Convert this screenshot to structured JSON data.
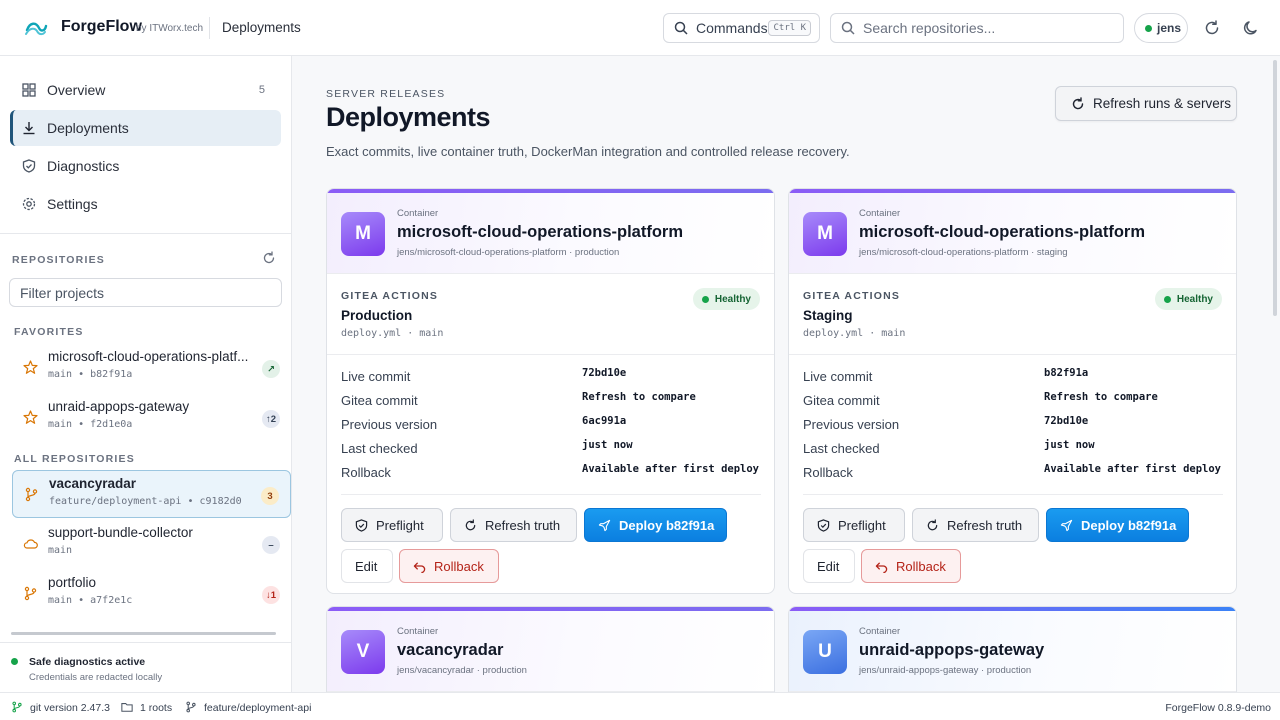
{
  "header": {
    "brand": "ForgeFlow",
    "brand_by": "by ITWorx.tech",
    "breadcrumb": "Deployments",
    "commands_label": "Commands",
    "commands_shortcut": "Ctrl K",
    "search_placeholder": "Search repositories...",
    "user": "jens",
    "icons": [
      "logo-icon",
      "search-icon",
      "refresh-icon",
      "moon-icon"
    ]
  },
  "sidebar": {
    "nav": [
      {
        "label": "Overview",
        "icon": "grid-icon",
        "count": "5"
      },
      {
        "label": "Deployments",
        "icon": "download-icon",
        "active": true
      },
      {
        "label": "Diagnostics",
        "icon": "shield-icon"
      },
      {
        "label": "Settings",
        "icon": "gear-icon"
      }
    ],
    "repositories_label": "REPOSITORIES",
    "filter_placeholder": "Filter projects",
    "favorites_label": "FAVORITES",
    "favorites": [
      {
        "name": "microsoft-cloud-operations-platf...",
        "sub": "main • b82f91a",
        "badge": "↗",
        "icon": "star-icon"
      },
      {
        "name": "unraid-appops-gateway",
        "sub": "main • f2d1e0a",
        "badge": "↑2",
        "icon": "star-icon"
      }
    ],
    "all_label": "ALL REPOSITORIES",
    "all": [
      {
        "name": "vacancyradar",
        "sub": "feature/deployment-api • c9182d0",
        "badge": "3",
        "icon": "branch-icon",
        "active": true
      },
      {
        "name": "support-bundle-collector",
        "sub": "main",
        "badge": "–",
        "icon": "cloud-icon"
      },
      {
        "name": "portfolio",
        "sub": "main • a7f2e1c",
        "badge": "↓1",
        "icon": "branch-icon"
      }
    ],
    "footer_title": "Safe diagnostics active",
    "footer_sub": "Credentials are redacted locally"
  },
  "main": {
    "kicker": "SERVER RELEASES",
    "title": "Deployments",
    "description": "Exact commits, live container truth, DockerMan integration and controlled release recovery.",
    "refresh_button": "Refresh runs & servers",
    "cards": [
      {
        "avatar": "M",
        "kind": "Container",
        "name": "microsoft-cloud-operations-platform",
        "path": "jens/microsoft-cloud-operations-platform · production",
        "actions_label": "GITEA ACTIONS",
        "env": "Production",
        "workflow": "deploy.yml · main",
        "health": "Healthy",
        "rows": [
          {
            "k": "Live commit",
            "v": "72bd10e"
          },
          {
            "k": "Gitea commit",
            "v": "Refresh to compare"
          },
          {
            "k": "Previous version",
            "v": "6ac991a"
          },
          {
            "k": "Last checked",
            "v": "just now"
          },
          {
            "k": "Rollback",
            "v": "Available after first deploy"
          }
        ],
        "preflight": "Preflight",
        "refresh_truth": "Refresh truth",
        "deploy": "Deploy b82f91a",
        "edit": "Edit",
        "rollback": "Rollback"
      },
      {
        "avatar": "M",
        "kind": "Container",
        "name": "microsoft-cloud-operations-platform",
        "path": "jens/microsoft-cloud-operations-platform · staging",
        "actions_label": "GITEA ACTIONS",
        "env": "Staging",
        "workflow": "deploy.yml · main",
        "health": "Healthy",
        "rows": [
          {
            "k": "Live commit",
            "v": "b82f91a"
          },
          {
            "k": "Gitea commit",
            "v": "Refresh to compare"
          },
          {
            "k": "Previous version",
            "v": "72bd10e"
          },
          {
            "k": "Last checked",
            "v": "just now"
          },
          {
            "k": "Rollback",
            "v": "Available after first deploy"
          }
        ],
        "preflight": "Preflight",
        "refresh_truth": "Refresh truth",
        "deploy": "Deploy b82f91a",
        "edit": "Edit",
        "rollback": "Rollback"
      },
      {
        "avatar": "V",
        "kind": "Container",
        "name": "vacancyradar",
        "path": "jens/vacancyradar · production"
      },
      {
        "avatar": "U",
        "kind": "Container",
        "name": "unraid-appops-gateway",
        "path": "jens/unraid-appops-gateway · production"
      }
    ]
  },
  "statusbar": {
    "git_version": "git version 2.47.3",
    "roots": "1 roots",
    "branch": "feature/deployment-api",
    "app_version": "ForgeFlow 0.8.9-demo"
  },
  "colors": {
    "accent": "#0b7fe0",
    "healthy_bg": "#e6f4ea",
    "healthy_text": "#166534",
    "danger": "#b42318",
    "avatar_purple": "#8b5cf6",
    "avatar_blue": "#3b6fe0"
  }
}
